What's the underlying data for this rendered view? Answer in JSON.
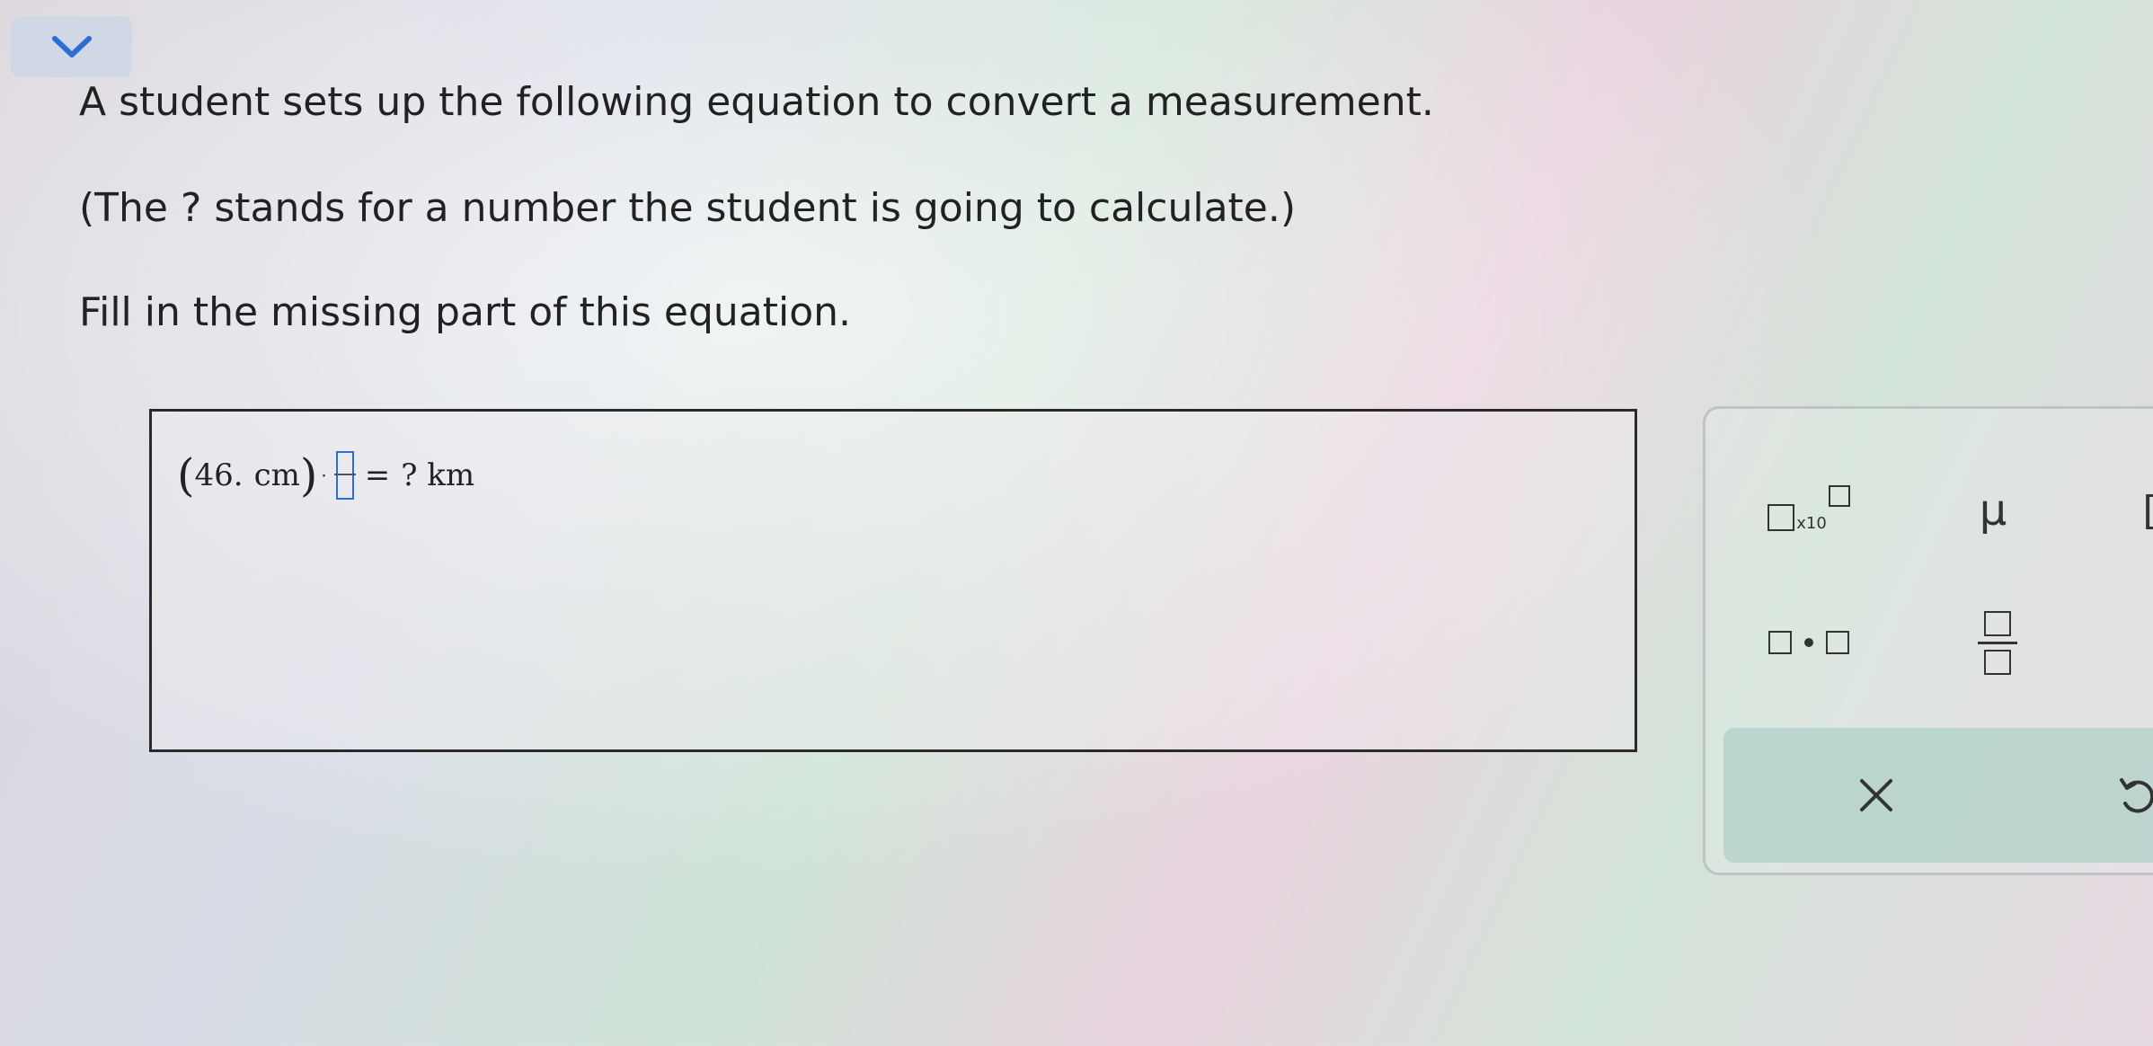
{
  "prompt": {
    "line1": "A student sets up the following equation to convert a measurement.",
    "line2": "(The ? stands for a number the student is going to calculate.)",
    "line3": "Fill in the missing part of this equation."
  },
  "equation": {
    "open_paren": "(",
    "value": "46.",
    "unit": "cm",
    "close_paren": ")",
    "multiply_dot": "·",
    "equals": "=",
    "result": "? km"
  },
  "toolbox": {
    "sci_notation_label": "x10",
    "mu_symbol": "μ",
    "bracket_symbol": "[",
    "clear_symbol": "×"
  },
  "colors": {
    "collapse_button_bg": "#cfd8e4",
    "chevron": "#2d6bd6",
    "input_slot_border": "#2d6bd6",
    "action_bar_bg": "#afd0c8"
  },
  "icons": {
    "collapse": "chevron-down-icon",
    "clear": "close-icon",
    "undo": "undo-icon"
  }
}
